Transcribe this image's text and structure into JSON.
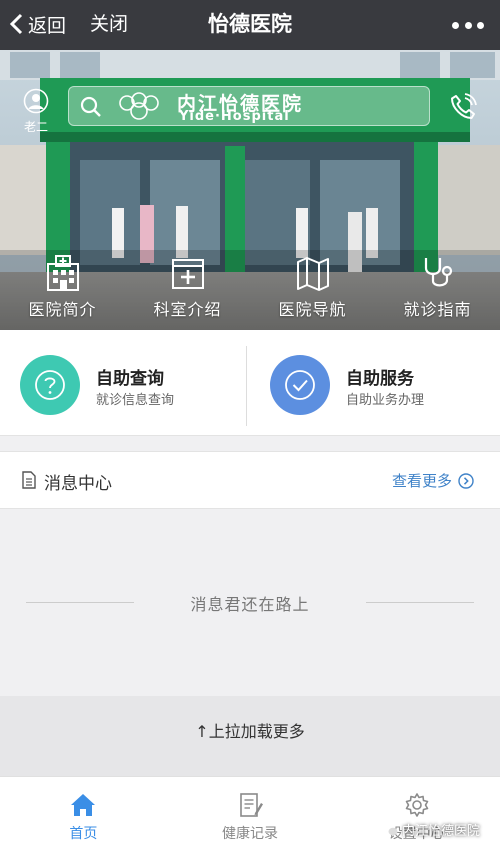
{
  "nav": {
    "back_label": "返回",
    "close_label": "关闭",
    "title": "怡德医院"
  },
  "hero": {
    "user_label": "老二",
    "sign_text": "内江怡德医院",
    "sign_english": "Yide·Hospital",
    "quick_nav": [
      {
        "label": "医院简介",
        "icon": "hospital-icon"
      },
      {
        "label": "科室介绍",
        "icon": "medical-cross-icon"
      },
      {
        "label": "医院导航",
        "icon": "map-icon"
      },
      {
        "label": "就诊指南",
        "icon": "stethoscope-icon"
      }
    ]
  },
  "services": [
    {
      "title": "自助查询",
      "subtitle": "就诊信息查询",
      "icon": "question-icon",
      "color": "#3ec9b2"
    },
    {
      "title": "自助服务",
      "subtitle": "自助业务办理",
      "icon": "check-icon",
      "color": "#5c8fe0"
    }
  ],
  "messages": {
    "title": "消息中心",
    "more_label": "查看更多",
    "empty_text": "消息君还在路上",
    "load_more": "↑上拉加载更多"
  },
  "tabbar": [
    {
      "label": "首页",
      "icon": "home-icon",
      "active": true
    },
    {
      "label": "健康记录",
      "icon": "record-icon",
      "active": false
    },
    {
      "label": "设置中心",
      "icon": "gear-icon",
      "active": false
    }
  ],
  "watermark": "内江怡德医院",
  "colors": {
    "nav_bar": "#393a3f",
    "accent_teal": "#3ec9b2",
    "accent_blue": "#5c8fe0",
    "link_blue": "#3f82c8",
    "active_tab": "#3a8ee6"
  }
}
